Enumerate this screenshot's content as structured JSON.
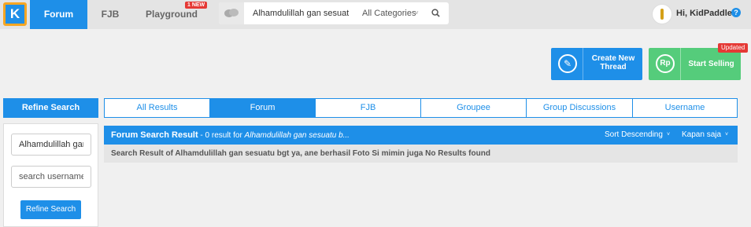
{
  "nav": {
    "logo": "K",
    "tabs": [
      {
        "label": "Forum",
        "active": true
      },
      {
        "label": "FJB",
        "active": false
      },
      {
        "label": "Playground",
        "active": false
      }
    ],
    "playground_badge": "1 NEW"
  },
  "search": {
    "value": "Alhamdulillah gan sesuatu b",
    "category": "All Categories",
    "caret": "˅"
  },
  "user": {
    "greeting": "Hi, KidPaddle",
    "help": "?"
  },
  "actions": {
    "create_label": "Create New Thread",
    "create_icon_glyph": "✎",
    "sell_label": "Start Selling",
    "sell_icon_glyph": "Rp",
    "updated_badge": "Updated"
  },
  "sidebar": {
    "title": "Refine Search",
    "keyword_value": "Alhamdulillah gan s",
    "username_placeholder": "search username",
    "button_label": "Refine Search"
  },
  "tabs": [
    {
      "label": "All Results",
      "active": false
    },
    {
      "label": "Forum",
      "active": true
    },
    {
      "label": "FJB",
      "active": false
    },
    {
      "label": "Groupee",
      "active": false
    },
    {
      "label": "Group Discussions",
      "active": false
    },
    {
      "label": "Username",
      "active": false
    }
  ],
  "results": {
    "title": "Forum Search Result",
    "count_text": " - 0 result for ",
    "query": "Alhamdulillah gan sesuatu b...",
    "sort_label": "Sort Descending",
    "time_label": "Kapan saja",
    "caret": "˅",
    "message": "Search Result of Alhamdulillah gan sesuatu bgt ya, ane berhasil Foto Si mimin juga No Results found"
  },
  "colors": {
    "primary": "#1e8fe8",
    "sell_green": "#55cc7b",
    "badge_red": "#e53935",
    "logo_border": "#f7a623"
  }
}
